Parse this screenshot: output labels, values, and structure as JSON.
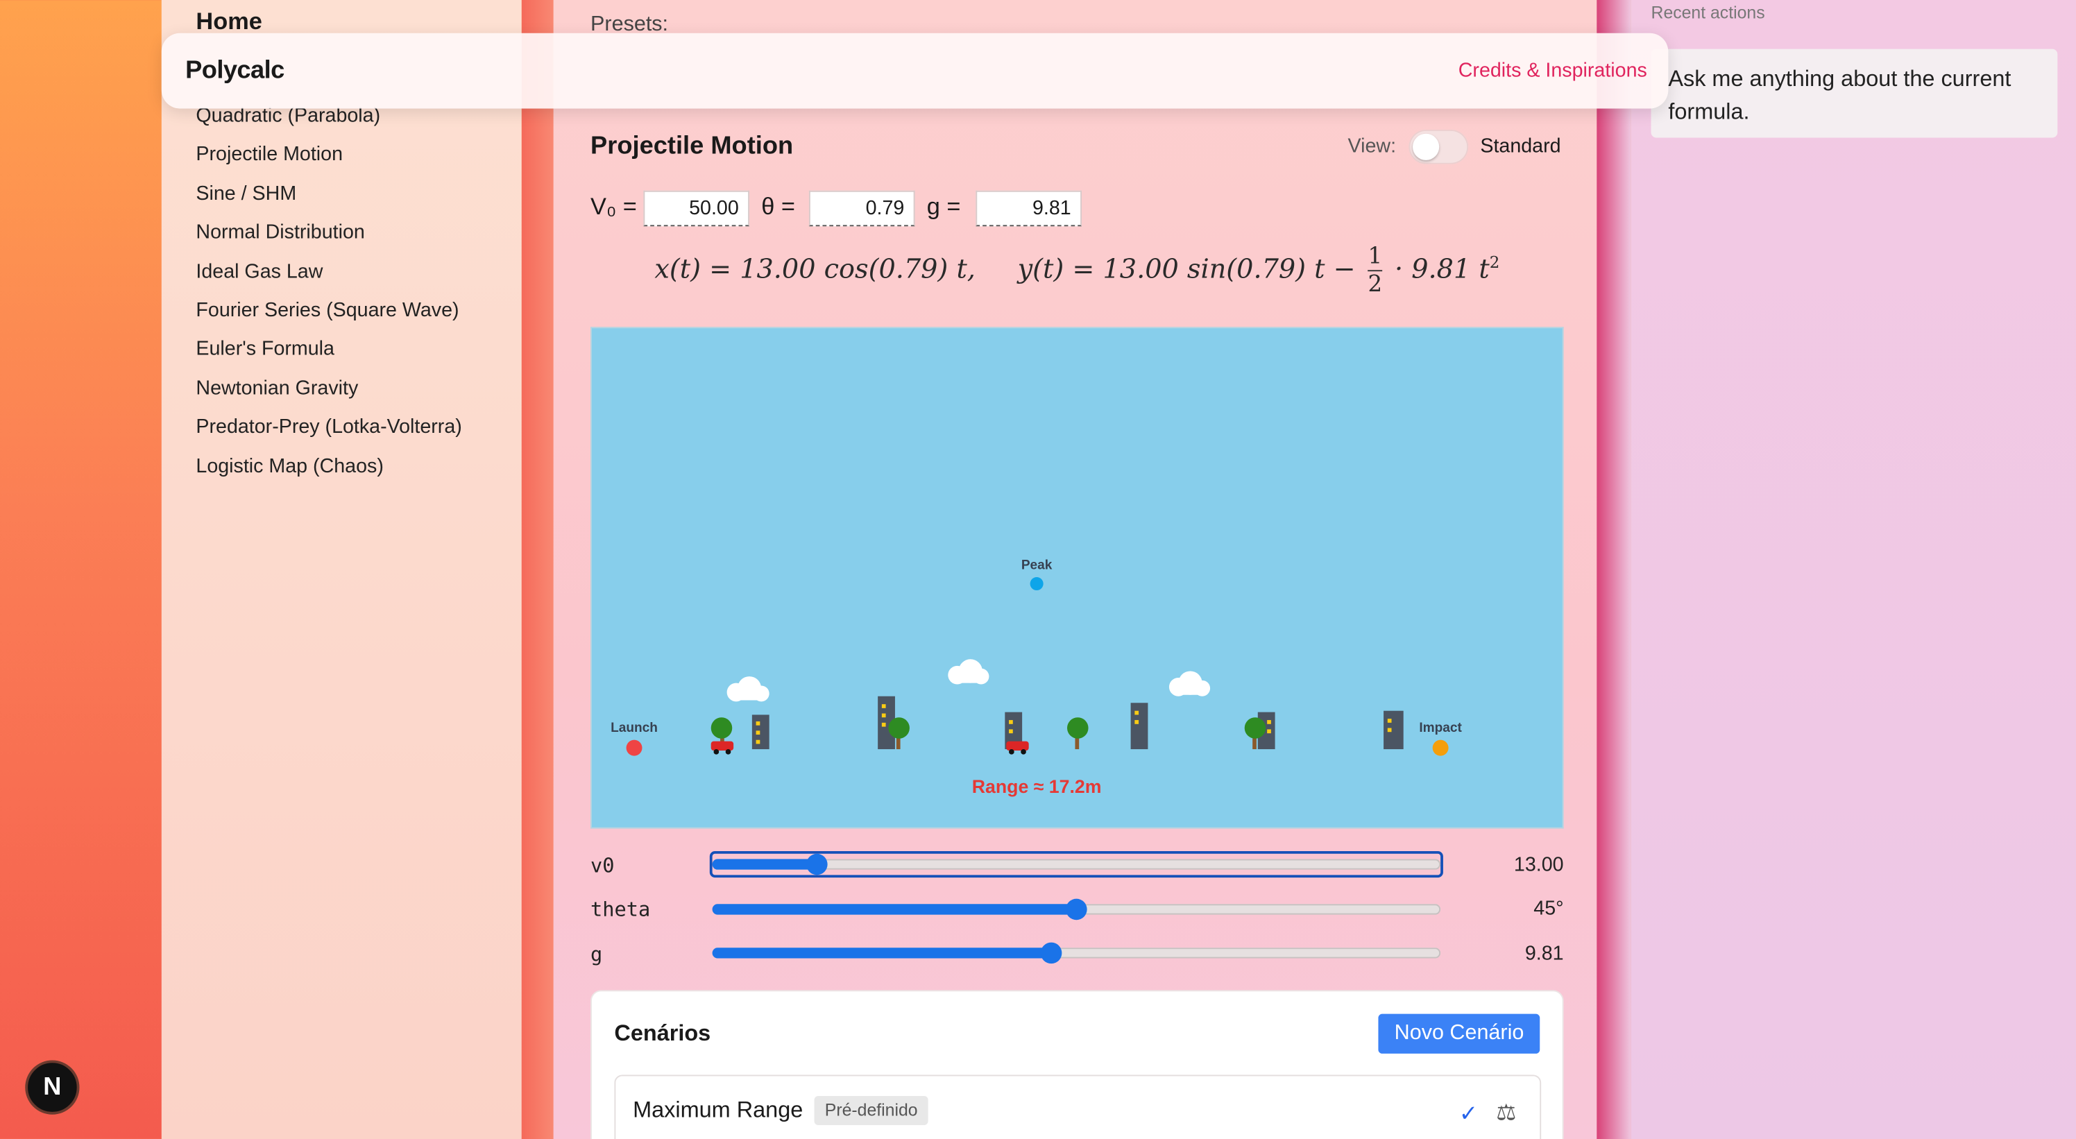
{
  "app": {
    "brand": "Polycalc",
    "credits_link": "Credits & Inspirations"
  },
  "sidebar": {
    "home": "Home",
    "items": [
      {
        "label": "Quadratic (Parabola)"
      },
      {
        "label": "Projectile Motion"
      },
      {
        "label": "Sine / SHM"
      },
      {
        "label": "Normal Distribution"
      },
      {
        "label": "Ideal Gas Law"
      },
      {
        "label": "Fourier Series (Square Wave)"
      },
      {
        "label": "Euler's Formula"
      },
      {
        "label": "Newtonian Gravity"
      },
      {
        "label": "Predator-Prey (Lotka-Volterra)"
      },
      {
        "label": "Logistic Map (Chaos)"
      }
    ]
  },
  "main": {
    "presets_label": "Presets:",
    "title": "Projectile Motion",
    "view_label": "View:",
    "view_value": "Standard",
    "view_toggle_on": false,
    "params": [
      {
        "label": "V₀ =",
        "value": "50.00"
      },
      {
        "label": "θ =",
        "value": "0.79"
      },
      {
        "label": "g =",
        "value": "9.81"
      }
    ],
    "equation": {
      "x_lhs": "x(t) = 13.00 cos(0.79) t,",
      "y_lhs": "y(t) = 13.00 sin(0.79) t −",
      "frac_num": "1",
      "frac_den": "2",
      "y_rhs": "· 9.81 t",
      "exp": "2"
    }
  },
  "simulation": {
    "sky_color": "#87ceeb",
    "labels": {
      "launch": "Launch",
      "peak": "Peak",
      "impact": "Impact",
      "range": "Range ≈ 17.2m"
    },
    "colors": {
      "launch": "#ef4444",
      "peak": "#0ea5e9",
      "impact": "#f59e0b",
      "range": "#e53935",
      "tree": "#2e8b22",
      "building": "#4b5563",
      "car": "#dc2626",
      "window": "#facc15"
    }
  },
  "sliders": [
    {
      "name": "v0",
      "value_text": "13.00",
      "fraction": 0.143,
      "focused": true
    },
    {
      "name": "theta",
      "value_text": "45°",
      "fraction": 0.5,
      "focused": false
    },
    {
      "name": "g",
      "value_text": "9.81",
      "fraction": 0.465,
      "focused": false
    }
  ],
  "scenarios": {
    "title": "Cenários",
    "new_button": "Novo Cenário",
    "items": [
      {
        "name": "Maximum Range",
        "badge": "Pré-definido"
      }
    ]
  },
  "right_panel": {
    "recent_label": "Recent actions",
    "assistant_prompt": "Ask me anything about the current formula."
  },
  "n_badge": "N"
}
